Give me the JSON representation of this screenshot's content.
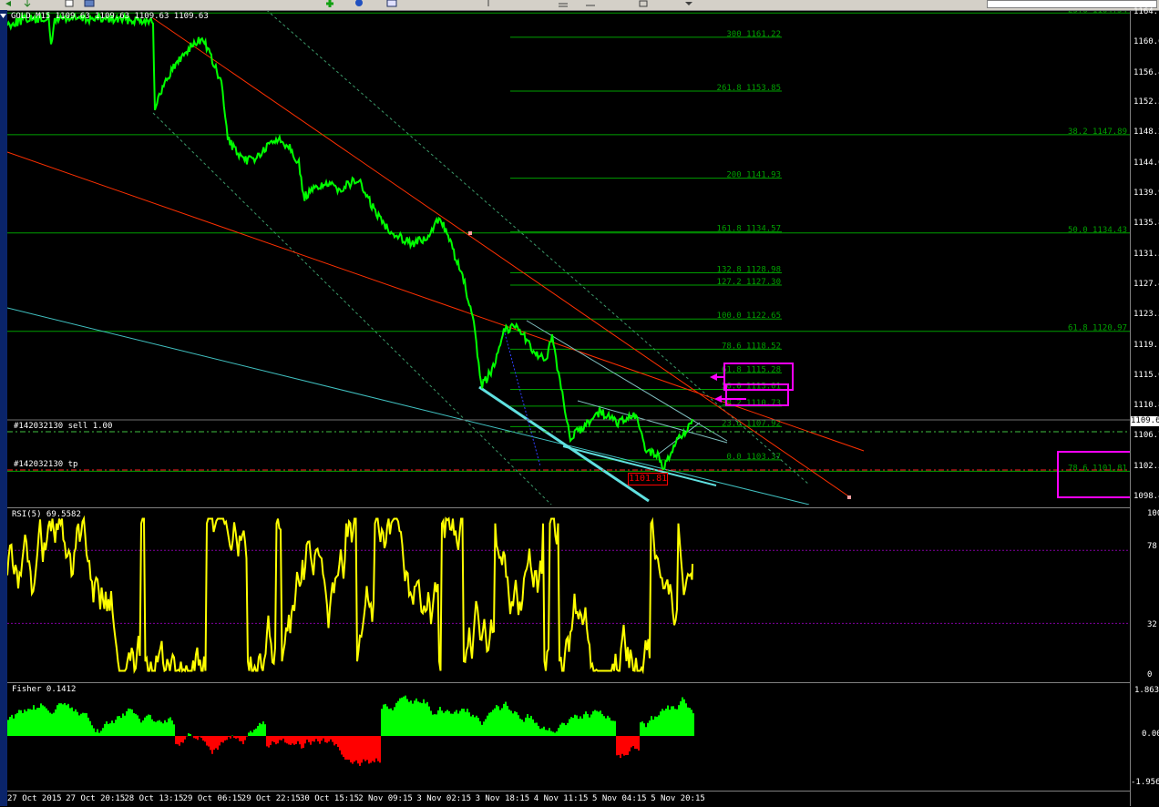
{
  "window": {
    "symbol_header": "GOLD,M15  1109.63 1109.63 1109.63 1109.63"
  },
  "colors": {
    "price": "#00ff00",
    "rsi": "#ffff00",
    "fisher_pos": "#00ff00",
    "fisher_neg": "#ff0000",
    "fib": "#00a000",
    "channel_dotted": "#3c9a6a",
    "channel_cyan": "#40c0c0",
    "trend_red": "#ff3000",
    "highlight": "#ff00ff"
  },
  "orders": [
    {
      "label": "#142032130 sell 1.00",
      "style": "sell"
    },
    {
      "label": "#142032130 tp",
      "style": "tp"
    }
  ],
  "low_label": "1101.81",
  "current_price": "1109.6",
  "price_scale": [
    "1164.7",
    "1160.6",
    "1156.4",
    "1152.3",
    "1148.2",
    "1144.0",
    "1139.9",
    "1135.8",
    "1131.5",
    "1127.4",
    "1123.3",
    "1119.1",
    "1115.0",
    "1110.8",
    "1106.7",
    "1102.5",
    "1098.4"
  ],
  "fib_left": [
    {
      "text": "300  1161.22"
    },
    {
      "text": "261.8  1153.85"
    },
    {
      "text": "200  1141.93"
    },
    {
      "text": "161.8  1134.57"
    },
    {
      "text": "132.8  1128.98"
    },
    {
      "text": "127.2  1127.30"
    },
    {
      "text": "100.0  1122.65"
    },
    {
      "text": "78.6  1118.52"
    },
    {
      "text": "61.8  1115.28"
    },
    {
      "text": "50.0  1113.01"
    },
    {
      "text": "38.2  1110.73"
    },
    {
      "text": "23.6  1107.92"
    },
    {
      "text": "0.0  1103.37"
    }
  ],
  "fib_right": [
    {
      "text": "23.6  1164.54"
    },
    {
      "text": "38.2  1147.89"
    },
    {
      "text": "50.0  1134.43"
    },
    {
      "text": "61.8  1120.97"
    },
    {
      "text": "78.6  1101.81"
    }
  ],
  "rsi": {
    "title": "RSI(5) 69.5582",
    "scale": [
      "100",
      "78",
      "32",
      "0"
    ]
  },
  "fisher": {
    "title": "Fisher 0.1412",
    "scale": [
      "1.8631",
      "0.00",
      "-1.9566"
    ]
  },
  "time_axis": [
    "27 Oct 2015",
    "27 Oct 20:15",
    "28 Oct 13:15",
    "29 Oct 06:15",
    "29 Oct 22:15",
    "30 Oct 15:15",
    "2 Nov 09:15",
    "3 Nov 02:15",
    "3 Nov 18:15",
    "4 Nov 11:15",
    "5 Nov 04:15",
    "5 Nov 20:15"
  ]
}
